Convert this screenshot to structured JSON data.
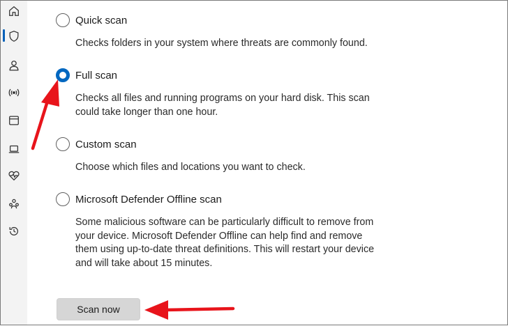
{
  "sidebar": {
    "items": [
      {
        "icon": "home-icon"
      },
      {
        "icon": "shield-icon",
        "active": true
      },
      {
        "icon": "account-icon"
      },
      {
        "icon": "network-icon"
      },
      {
        "icon": "app-browser-icon"
      },
      {
        "icon": "device-security-icon"
      },
      {
        "icon": "device-health-icon"
      },
      {
        "icon": "family-icon"
      },
      {
        "icon": "history-icon"
      }
    ]
  },
  "scan_options": [
    {
      "title": "Quick scan",
      "checked": false,
      "description": "Checks folders in your system where threats are commonly found."
    },
    {
      "title": "Full scan",
      "checked": true,
      "description_lines": [
        "Checks all files and running programs on your hard disk. This scan",
        "could take longer than one hour."
      ]
    },
    {
      "title": "Custom scan",
      "checked": false,
      "description": "Choose which files and locations you want to check."
    },
    {
      "title": "Microsoft Defender Offline scan",
      "checked": false,
      "description_lines": [
        "Some malicious software can be particularly difficult to remove from",
        "your device. Microsoft Defender Offline can help find and remove",
        "them using up-to-date threat definitions. This will restart your device",
        "and will take about 15 minutes."
      ]
    }
  ],
  "scan_button_label": "Scan now",
  "colors": {
    "accent": "#0067c0",
    "annotation_arrow": "#e8141b",
    "sidebar_bg": "#f3f3f3"
  }
}
